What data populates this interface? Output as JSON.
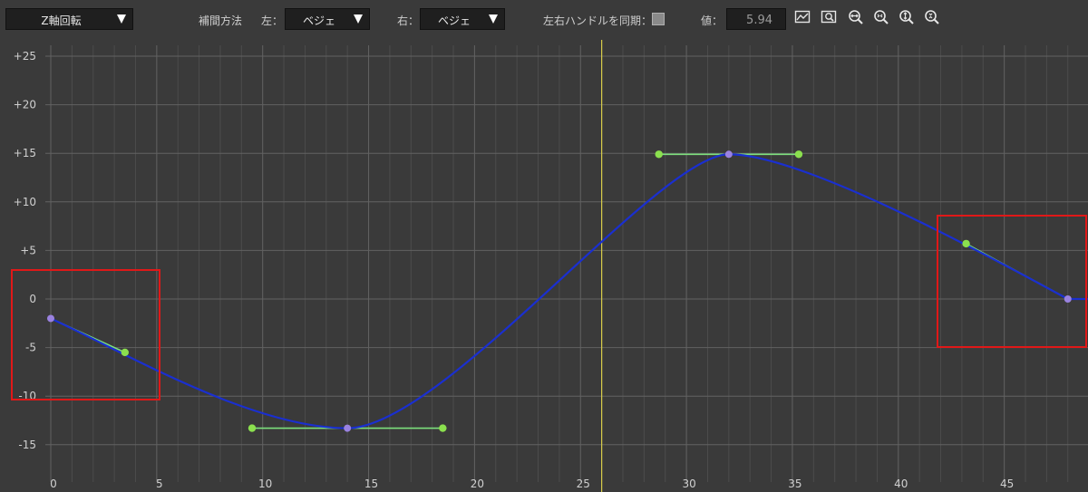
{
  "toolbar": {
    "channel_dropdown": "Z軸回転",
    "interp_label": "補間方法",
    "left_label": "左：",
    "left_value": "ベジェ",
    "right_label": "右：",
    "right_value": "ベジェ",
    "sync_label": "左右ハンドルを同期：",
    "sync_checked": false,
    "value_label": "値：",
    "value": "5.94",
    "icons": [
      "fit-view-icon",
      "zoom-fit-icon",
      "zoom-in-horizontal-icon",
      "zoom-out-horizontal-icon",
      "zoom-in-vertical-icon",
      "zoom-out-vertical-icon"
    ]
  },
  "graph": {
    "x_ticks": [
      "0",
      "5",
      "10",
      "15",
      "20",
      "25",
      "30",
      "35",
      "40",
      "45"
    ],
    "y_ticks": [
      "+25",
      "+20",
      "+15",
      "+10",
      "+5",
      "0",
      "-5",
      "-10",
      "-15"
    ],
    "x_tick_values": [
      0,
      5,
      10,
      15,
      20,
      25,
      30,
      35,
      40,
      45
    ],
    "y_tick_values": [
      25,
      20,
      15,
      10,
      5,
      0,
      -5,
      -10,
      -15
    ],
    "x_range": [
      0,
      48
    ],
    "current_frame": 26,
    "keyframes": [
      {
        "frame": 0,
        "value": -2,
        "handle_out": [
          3.5,
          -5.5
        ]
      },
      {
        "frame": 14,
        "value": -13.3,
        "handle_in": [
          9.5,
          -13.3
        ],
        "handle_out": [
          18.5,
          -13.3
        ]
      },
      {
        "frame": 32,
        "value": 14.9,
        "handle_in": [
          28.7,
          14.9
        ],
        "handle_out": [
          35.3,
          14.9
        ]
      },
      {
        "frame": 48,
        "value": 0,
        "handle_in": [
          43.2,
          5.7
        ]
      }
    ],
    "colors": {
      "background": "#3a3a3a",
      "grid_major": "#626262",
      "grid_minor": "#4c4c4c",
      "curve": "#1a2fd0",
      "handle_line": "#7de07d",
      "handle_point": "#8be04e",
      "key_point": "#9a82e0",
      "playhead": "#d8cc4a",
      "highlight_box": "#e01818"
    }
  }
}
